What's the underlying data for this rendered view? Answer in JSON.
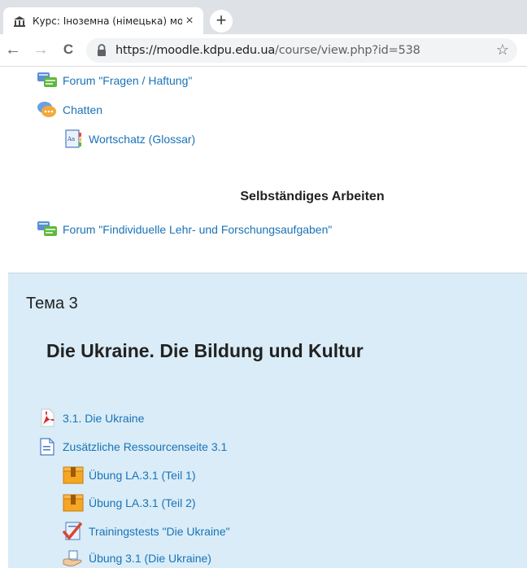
{
  "browser": {
    "tab_title": "Курс: Іноземна (німецька) мова",
    "tab_close": "×",
    "new_tab": "+",
    "url_host": "https://moodle.kdpu.edu.ua",
    "url_path": "/course/view.php?id=538",
    "back": "←",
    "forward": "→",
    "reload": "C",
    "star": "☆"
  },
  "top_activities": [
    {
      "label": "Forum \"Fragen / Haftung\"",
      "icon": "forum-icon"
    },
    {
      "label": "Chatten",
      "icon": "chat-icon"
    },
    {
      "label": "Wortschatz (Glossar)",
      "icon": "glossary-icon"
    }
  ],
  "subheading": "Selbständiges Arbeiten",
  "forum2": {
    "label": "Forum \"Findividuelle Lehr- und Forschungsaufgaben\"",
    "icon": "forum-icon"
  },
  "section": {
    "name": "Тема 3",
    "title": "Die Ukraine. Die Bildung und Kultur",
    "activities": [
      {
        "label": "3.1. Die Ukraine",
        "icon": "pdf-icon"
      },
      {
        "label": "Zusätzliche Ressourcenseite 3.1",
        "icon": "page-icon"
      },
      {
        "label": "Übung LA.3.1 (Teil 1)",
        "icon": "package-icon"
      },
      {
        "label": "Übung LA.3.1 (Teil 2)",
        "icon": "package-icon"
      },
      {
        "label": "Trainingstests \"Die Ukraine\"",
        "icon": "quiz-icon"
      },
      {
        "label": "Übung 3.1 (Die Ukraine)",
        "icon": "assignment-icon"
      }
    ]
  },
  "colors": {
    "link": "#1a73b8",
    "section_bg": "#d9ecf7"
  }
}
